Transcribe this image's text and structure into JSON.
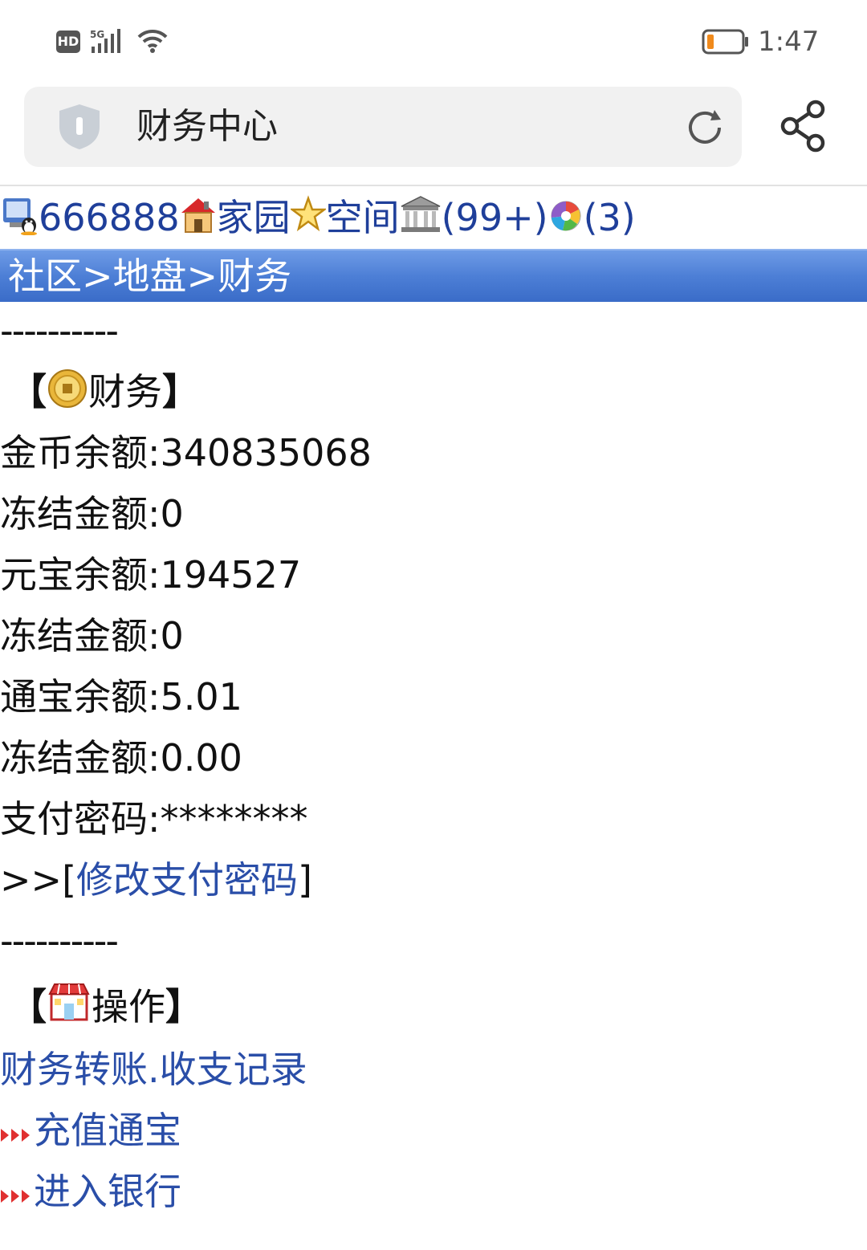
{
  "status_bar": {
    "network_badge": "HD",
    "network_type": "5G",
    "time": "1:47"
  },
  "browser": {
    "page_title": "财务中心"
  },
  "user_row": {
    "user_id": "666888",
    "home_label": "家园",
    "space_label": "空间",
    "messages_count": "(99+)",
    "photos_count": "(3)"
  },
  "breadcrumb": "社区>地盘>财务",
  "divider": "----------",
  "finance": {
    "open_bracket": "【",
    "close_bracket": "】",
    "heading": "财务",
    "rows": [
      {
        "label": "金币余额:",
        "value": "340835068"
      },
      {
        "label": "冻结金额:",
        "value": "0"
      },
      {
        "label": "元宝余额:",
        "value": "194527"
      },
      {
        "label": "冻结金额:",
        "value": "0"
      },
      {
        "label": "通宝余额:",
        "value": "5.01"
      },
      {
        "label": "冻结金额:",
        "value": "0.00"
      },
      {
        "label": "支付密码:",
        "value": "********"
      }
    ],
    "change_prefix": ">>[",
    "change_link": "修改支付密码",
    "change_suffix": "]"
  },
  "operations": {
    "heading": "操作",
    "links": {
      "transfer": "财务转账",
      "dot": ".",
      "records": "收支记录",
      "recharge": "充值通宝",
      "bank": "进入银行"
    }
  },
  "icons": {
    "signal": "signal-icon",
    "wifi": "wifi-icon",
    "battery": "battery-icon",
    "shield": "shield-icon",
    "reload": "reload-icon",
    "share": "share-icon",
    "user": "user-icon",
    "home": "house-icon",
    "space": "star-icon",
    "messages": "bank-icon",
    "photos": "photo-icon",
    "coin": "coin-icon",
    "shop": "shop-icon",
    "arrow": "triple-arrow-icon"
  },
  "colors": {
    "link": "#2a4ea8",
    "banner": "#4d7fd6",
    "battery_low": "#f08a1c"
  }
}
